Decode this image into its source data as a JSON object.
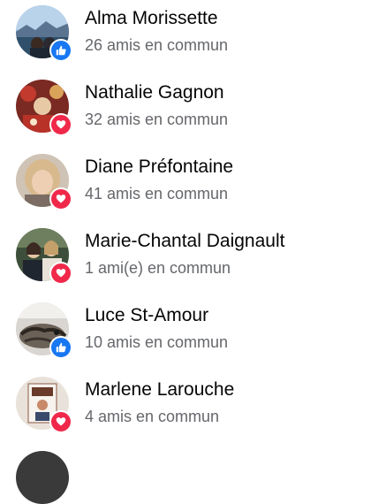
{
  "friends": [
    {
      "name": "Alma Morissette",
      "mutual": "26 amis en commun",
      "reaction": "like-icon"
    },
    {
      "name": "Nathalie Gagnon",
      "mutual": "32 amis en commun",
      "reaction": "love-icon"
    },
    {
      "name": "Diane Préfontaine",
      "mutual": "41 amis en commun",
      "reaction": "love-icon"
    },
    {
      "name": "Marie-Chantal Daignault",
      "mutual": "1 ami(e) en commun",
      "reaction": "love-icon"
    },
    {
      "name": "Luce St-Amour",
      "mutual": "10 amis en commun",
      "reaction": "like-icon"
    },
    {
      "name": "Marlene Larouche",
      "mutual": "4 amis en commun",
      "reaction": "love-icon"
    }
  ],
  "colors": {
    "like": "#1877f2",
    "love": "#f0284a",
    "name_text": "#050505",
    "secondary_text": "#65676b"
  }
}
